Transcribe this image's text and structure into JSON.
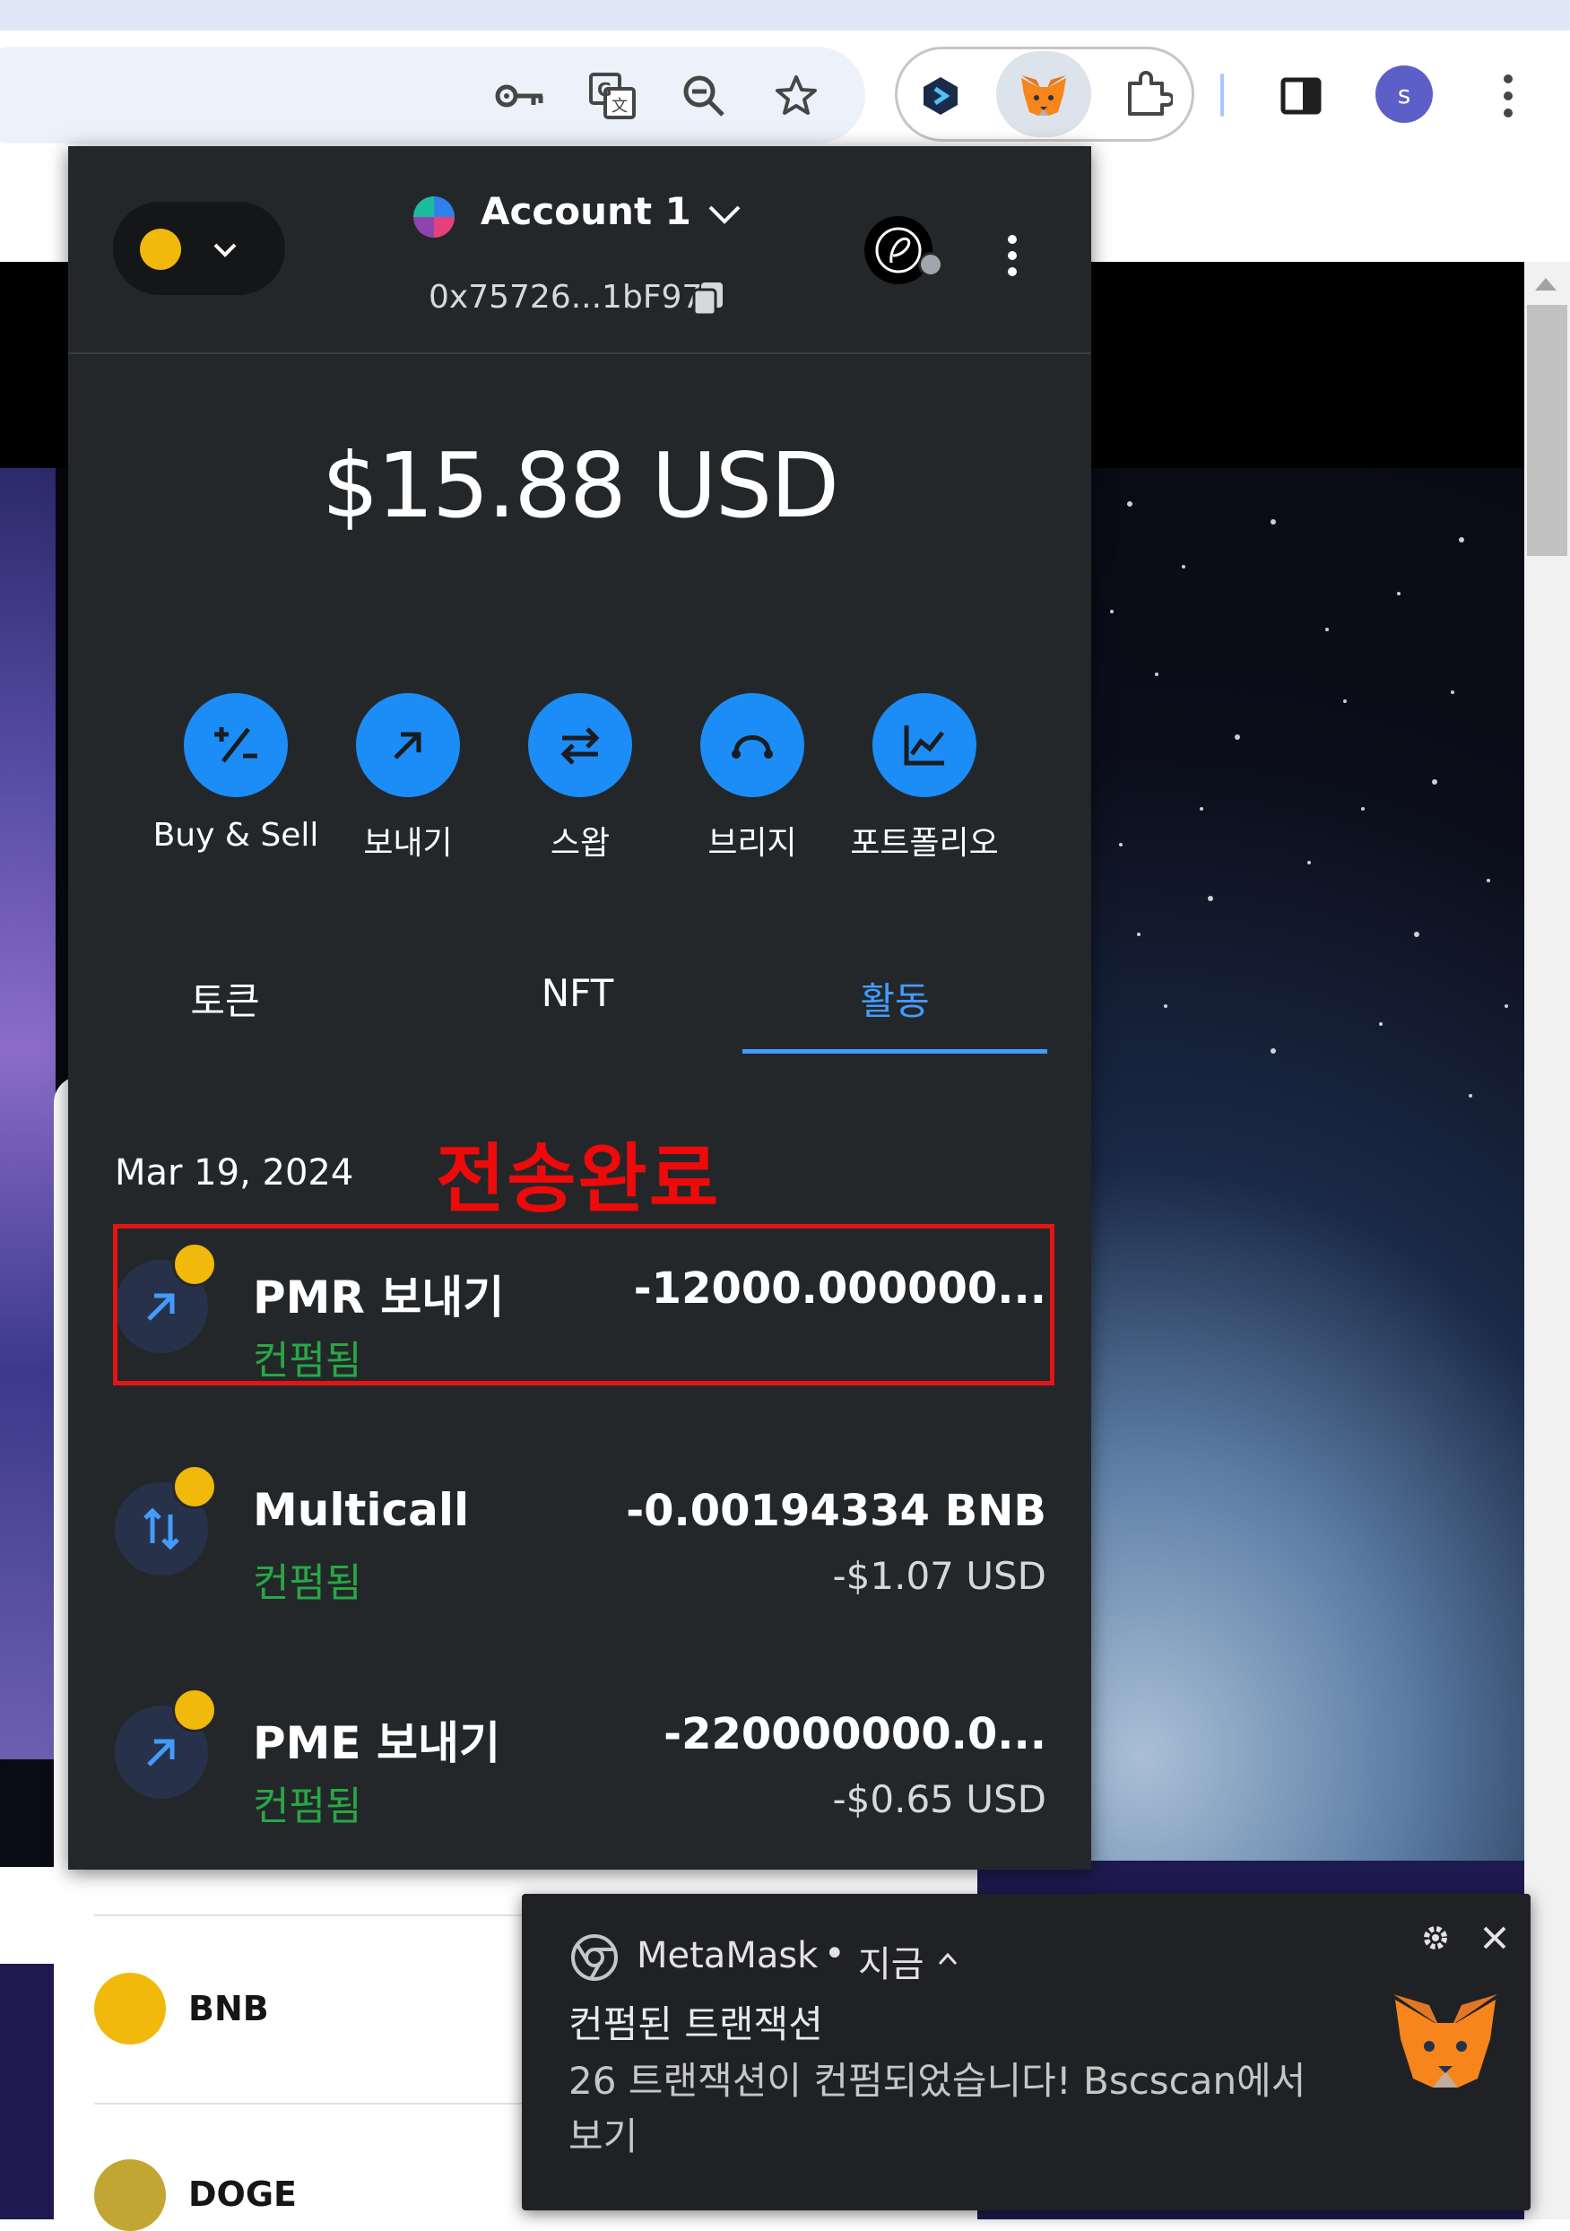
{
  "browser": {
    "avatar_letter": "s",
    "toolbar_icons": [
      "key-icon",
      "translate-icon",
      "zoom-out-icon",
      "star-icon"
    ],
    "extension_icons": [
      "extension-a-icon",
      "metamask-fox-icon",
      "puzzle-icon"
    ],
    "colors": {
      "accent": "#1c8cf6",
      "highlight": "#e31414",
      "confirmed": "#28a745"
    }
  },
  "wallet": {
    "account_name": "Account 1",
    "address": "0x75726...1bF97",
    "balance": "$15.88 USD",
    "actions": [
      {
        "label": "Buy & Sell"
      },
      {
        "label": "보내기"
      },
      {
        "label": "스왑"
      },
      {
        "label": "브리지"
      },
      {
        "label": "포트폴리오"
      }
    ],
    "tabs": [
      {
        "label": "토큰"
      },
      {
        "label": "NFT"
      },
      {
        "label": "활동"
      }
    ],
    "activity_date": "Mar 19, 2024",
    "annotation": "전송완료",
    "transactions": [
      {
        "title": "PMR 보내기",
        "status": "컨펌됨",
        "amount": "-12000.000000...",
        "usd": ""
      },
      {
        "title": "Multicall",
        "status": "컨펌됨",
        "amount": "-0.00194334 BNB",
        "usd": "-$1.07 USD"
      },
      {
        "title": "PME 보내기",
        "status": "컨펌됨",
        "amount": "-220000000.0...",
        "usd": "-$0.65 USD"
      }
    ]
  },
  "page_behind": {
    "tokens": [
      {
        "label": "BNB"
      },
      {
        "label": "DOGE"
      }
    ]
  },
  "notification": {
    "app": "MetaMask",
    "separator": "•",
    "time": "지금",
    "title": "컨펌된 트랜잭션",
    "body": "26 트랜잭션이 컨펌되었습니다! Bscscan에서 보기"
  }
}
